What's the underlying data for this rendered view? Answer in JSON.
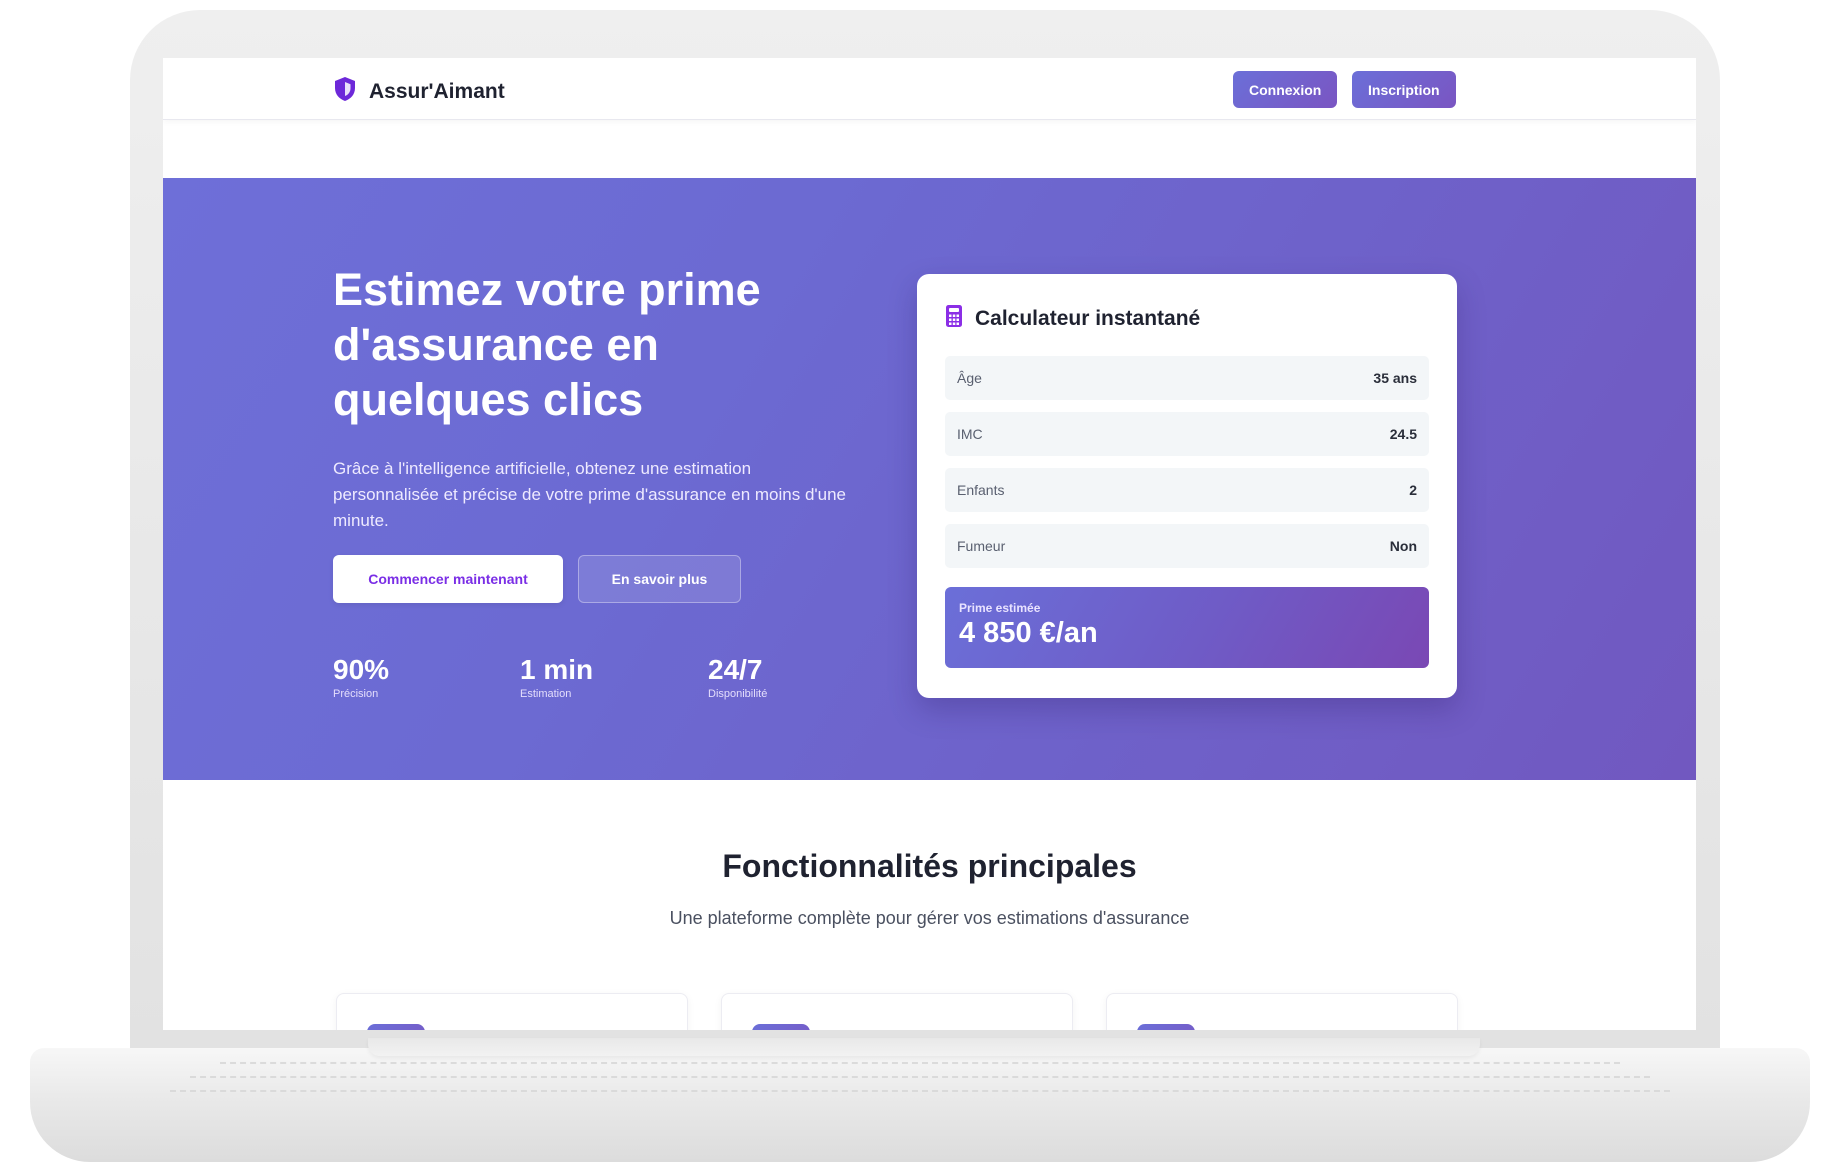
{
  "navbar": {
    "brand": "Assur'Aimant",
    "login_label": "Connexion",
    "signup_label": "Inscription"
  },
  "hero": {
    "title": "Estimez votre prime d'assurance en quelques clics",
    "subtitle": "Grâce à l'intelligence artificielle, obtenez une estimation personnalisée et précise de votre prime d'assurance en moins d'une minute.",
    "cta_primary": "Commencer maintenant",
    "cta_secondary": "En savoir plus",
    "stats": [
      {
        "value": "90%",
        "label": "Précision"
      },
      {
        "value": "1 min",
        "label": "Estimation"
      },
      {
        "value": "24/7",
        "label": "Disponibilité"
      }
    ]
  },
  "calculator": {
    "title": "Calculateur instantané",
    "icon": "calculator-icon",
    "rows": [
      {
        "label": "Âge",
        "value": "35 ans"
      },
      {
        "label": "IMC",
        "value": "24.5"
      },
      {
        "label": "Enfants",
        "value": "2"
      },
      {
        "label": "Fumeur",
        "value": "Non"
      }
    ],
    "premium_label": "Prime estimée",
    "premium_value": "4 850 €/an"
  },
  "features": {
    "title": "Fonctionnalités principales",
    "subtitle": "Une plateforme complète pour gérer vos estimations d'assurance"
  },
  "colors": {
    "brand_purple": "#7a2ee6",
    "hero_gradient_start": "#6e6fd8",
    "hero_gradient_end": "#7158c0"
  }
}
